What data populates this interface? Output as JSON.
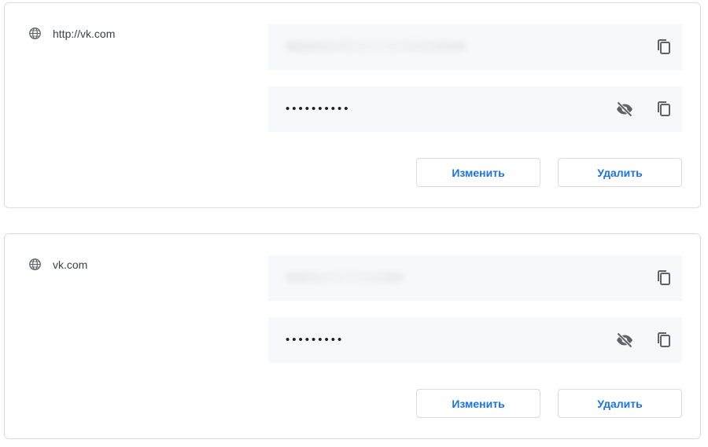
{
  "entries": [
    {
      "site": "http://vk.com",
      "password_mask": "••••••••••",
      "edit_label": "Изменить",
      "delete_label": "Удалить"
    },
    {
      "site": "vk.com",
      "password_mask": "•••••••••",
      "edit_label": "Изменить",
      "delete_label": "Удалить"
    }
  ],
  "icons": {
    "site": "globe-icon",
    "show_password": "eye-off-icon",
    "copy": "copy-icon"
  },
  "colors": {
    "accent": "#1a73e8",
    "field_bg": "#f7f8f9",
    "border": "#dadce0",
    "icon": "#5f6368"
  }
}
